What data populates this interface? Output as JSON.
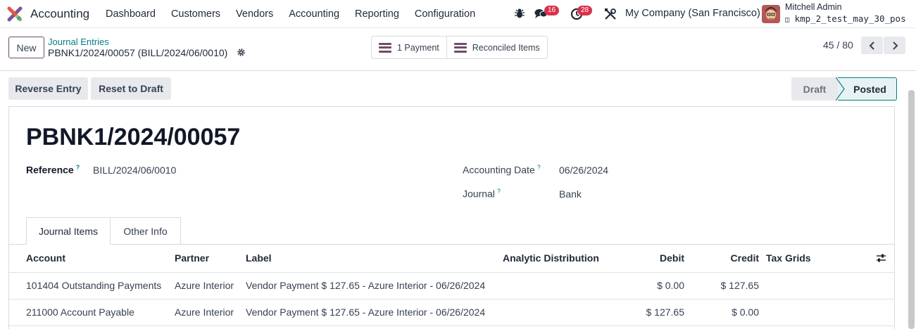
{
  "app": {
    "name": "Accounting"
  },
  "menu": [
    "Dashboard",
    "Customers",
    "Vendors",
    "Accounting",
    "Reporting",
    "Configuration"
  ],
  "systray": {
    "messages_count": "16",
    "activities_count": "28",
    "company": "My Company (San Francisco)",
    "user_name": "Mitchell Admin",
    "db_name": "kmp_2_test_may_30_pos"
  },
  "control": {
    "new_label": "New",
    "breadcrumb_parent": "Journal Entries",
    "breadcrumb_current": "PBNK1/2024/00057 (BILL/2024/06/0010)",
    "smart_buttons": [
      "1 Payment",
      "Reconciled Items"
    ],
    "pager": "45 / 80"
  },
  "actions": {
    "reverse": "Reverse Entry",
    "reset": "Reset to Draft"
  },
  "statusbar": {
    "draft": "Draft",
    "posted": "Posted",
    "active": "Posted"
  },
  "form": {
    "title": "PBNK1/2024/00057",
    "reference_label": "Reference",
    "reference_value": "BILL/2024/06/0010",
    "accounting_date_label": "Accounting Date",
    "accounting_date_value": "06/26/2024",
    "journal_label": "Journal",
    "journal_value": "Bank",
    "help_mark": "?"
  },
  "tabs": [
    "Journal Items",
    "Other Info"
  ],
  "table": {
    "headers": [
      "Account",
      "Partner",
      "Label",
      "Analytic Distribution",
      "Debit",
      "Credit",
      "Tax Grids"
    ],
    "rows": [
      {
        "account": "101404 Outstanding Payments",
        "partner": "Azure Interior",
        "label": "Vendor Payment $ 127.65 - Azure Interior - 06/26/2024",
        "analytic": "",
        "debit": "$ 0.00",
        "credit": "$ 127.65",
        "tax": ""
      },
      {
        "account": "211000 Account Payable",
        "partner": "Azure Interior",
        "label": "Vendor Payment $ 127.65 - Azure Interior - 06/26/2024",
        "analytic": "",
        "debit": "$ 127.65",
        "credit": "$ 0.00",
        "tax": ""
      }
    ]
  },
  "colors": {
    "brand": "#714b67",
    "accent": "#017e84",
    "badge": "#d9334b"
  }
}
